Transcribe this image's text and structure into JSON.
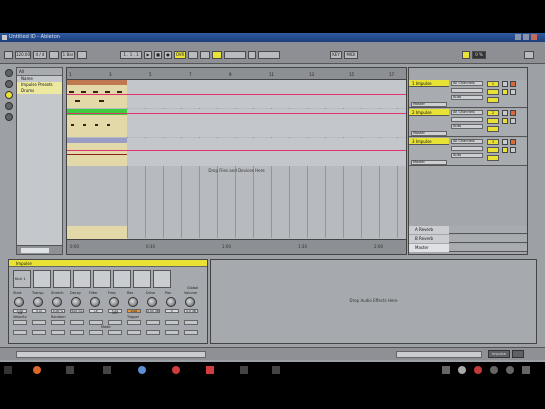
{
  "window": {
    "title": "Untitled ID - Ableton"
  },
  "transport": {
    "tempo": "120.00",
    "signature": "4 / 4",
    "position": "1 . 1 . 1",
    "loop_label": "OVR",
    "quant_label": "1 Bar",
    "key_label": "KEY",
    "midi_label": "MIDI",
    "cpu": "0 %"
  },
  "browser": {
    "header": "All",
    "col_label": "Name",
    "items": [
      "Impulse Presets",
      "Drums"
    ]
  },
  "arrangement": {
    "ruler_ticks": [
      "1",
      "3",
      "5",
      "7",
      "9",
      "11",
      "13",
      "15",
      "17"
    ],
    "drop_message": "Drop Files and Devices Here",
    "time_ticks": [
      "0:00",
      "0:30",
      "1:00",
      "1:30",
      "2:00",
      "2:30"
    ]
  },
  "tracks": [
    {
      "name": "1 Impulse",
      "input": "All Channels",
      "monitor": "Auto",
      "route": "Master",
      "num": "1"
    },
    {
      "name": "2 Impulse",
      "input": "All Channels",
      "monitor": "Auto",
      "route": "Master",
      "num": "2"
    },
    {
      "name": "3 Impulse",
      "input": "All Channels",
      "monitor": "Auto",
      "route": "Master",
      "num": "3"
    }
  ],
  "returns": [
    {
      "name": "A Reverb"
    },
    {
      "name": "B Reverb"
    },
    {
      "name": "Master"
    }
  ],
  "device": {
    "name": "Impulse",
    "pad_label": "Kick 1",
    "knob_labels": [
      "Start",
      "Transp",
      "Stretch",
      "Decay",
      "Filter",
      "Freq",
      "Res",
      "Drive",
      "Pan",
      "Volume"
    ],
    "knob_values": [
      "0.00 ms",
      "0 st",
      "0.00 %",
      "500 ms",
      "LP",
      "3.02 kHz",
      "0.00",
      "0.00 dB",
      "C",
      "0.0 dB"
    ],
    "velocity_label": "Velocity",
    "random_label": "Random",
    "mode_label": "Mode",
    "trigger_label": "Trigger",
    "soft_label": "Soft",
    "saturator_label": "Sat",
    "global": "Global"
  },
  "effect_drop": {
    "message": "Drop Audio Effects Here"
  },
  "colors": {
    "accent": "#e8e237",
    "clip": "#e2d8a8",
    "clip_green": "#3ecb3e",
    "automation": "#e0336e"
  }
}
